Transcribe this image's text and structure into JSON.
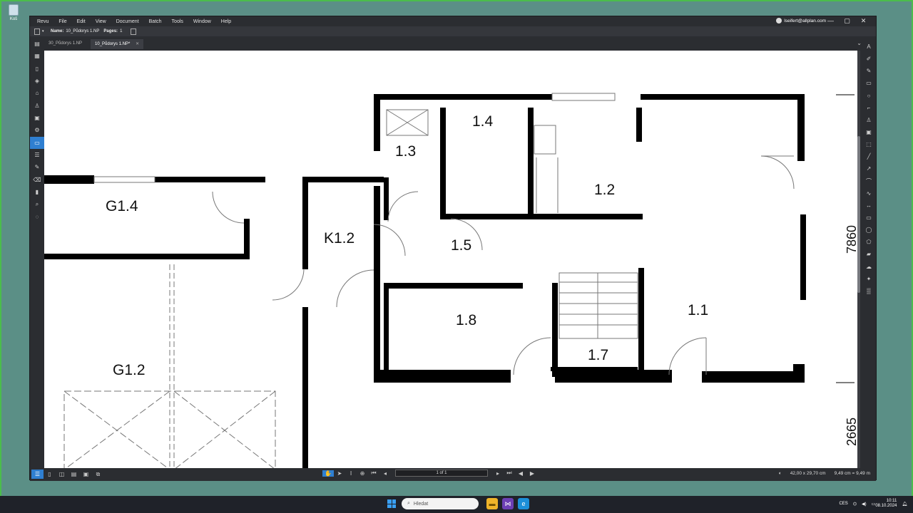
{
  "desktop": {
    "recycle_label": "Koš"
  },
  "menu": [
    "Revu",
    "File",
    "Edit",
    "View",
    "Document",
    "Batch",
    "Tools",
    "Window",
    "Help"
  ],
  "account": {
    "email": "lseifert@allplan.com"
  },
  "window_controls": [
    "—",
    "▢",
    "✕"
  ],
  "properties": {
    "name_label": "Name:",
    "name_value": "10_Půdorys 1.NP",
    "pages_label": "Pages:",
    "pages_value": "1"
  },
  "tabs": [
    {
      "label": "30_Půdorys 1.NP",
      "active": false
    },
    {
      "label": "10_Půdorys 1.NP*",
      "active": true
    }
  ],
  "drawing": {
    "room_labels": [
      "1.4",
      "1.3",
      "1.2",
      "G1.4",
      "K1.2",
      "1.5",
      "1.8",
      "1.1",
      "1.7",
      "G1.2"
    ],
    "dimension_labels": [
      "7860",
      "2665"
    ]
  },
  "status": {
    "page_indicator": "1 of 1",
    "page_size": "42,00 x 29,70 cm",
    "cursor_pos": "9,49 cm = 9,49 m"
  },
  "taskbar": {
    "search_placeholder": "Hledat",
    "language": "CES",
    "time": "10:11",
    "date": "08.10.2024"
  }
}
